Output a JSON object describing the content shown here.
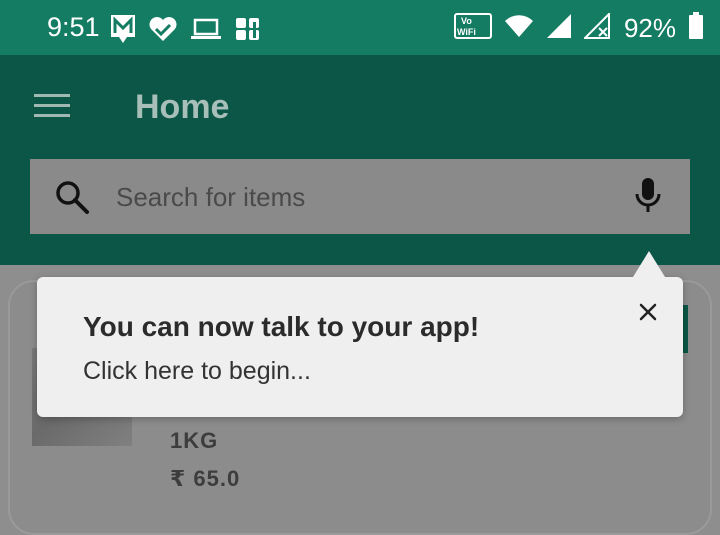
{
  "status_bar": {
    "time": "9:51",
    "left_icons": [
      "gmail-icon",
      "health-icon",
      "laptop-icon",
      "app-icon"
    ],
    "vowifi_label_top": "Vo",
    "vowifi_label_bottom": "WiFi",
    "battery_percent": "92%"
  },
  "app_bar": {
    "title": "Home"
  },
  "search": {
    "placeholder": "Search for items",
    "value": ""
  },
  "product": {
    "quantity": "1KG",
    "price": "₹ 65.0"
  },
  "tooltip": {
    "title": "You can now talk to your app!",
    "body": "Click here to begin..."
  },
  "colors": {
    "status_bar": "#147c62",
    "app_bar": "#0b5646",
    "overlay": "#8e8e8e",
    "tooltip_bg": "#efefef"
  }
}
